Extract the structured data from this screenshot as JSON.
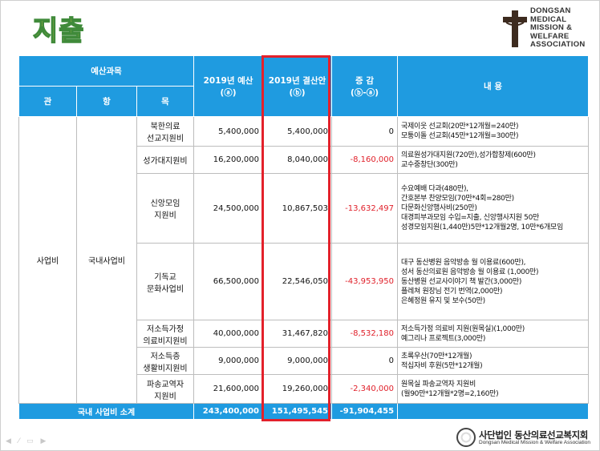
{
  "title": "지출",
  "logo": {
    "lines": [
      "DONGSAN",
      "MEDICAL",
      "MISSION &",
      "WELFARE",
      "ASSOCIATION"
    ],
    "icon": "cross-icon"
  },
  "table": {
    "header": {
      "budget_category": "예산과목",
      "budget_2019": "2019년 예산",
      "budget_2019_sub": "(ⓐ)",
      "settlement_2019": "2019년 결산안",
      "settlement_2019_sub": "(ⓑ)",
      "change": "증  감",
      "change_sub": "(ⓑ-ⓐ)",
      "content": "내    용",
      "gwan": "관",
      "hang": "항",
      "mok": "목"
    },
    "gwan": "사업비",
    "hang": "국내사업비",
    "rows": [
      {
        "mok": [
          "북한의료",
          "선교지원비"
        ],
        "budget": "5,400,000",
        "settlement": "5,400,000",
        "change": "0",
        "negative": false,
        "notes": [
          "국제이웃 선교회(20만*12개월=240만)",
          "모퉁이돌 선교회(45만*12개월=300만)"
        ]
      },
      {
        "mok": [
          "성가대지원비"
        ],
        "budget": "16,200,000",
        "settlement": "8,040,000",
        "change": "-8,160,000",
        "negative": true,
        "notes": [
          "의료원성가대지원(720만),성가합창제(600만)",
          "교수중창단(300만)"
        ]
      },
      {
        "mok": [
          "신앙모임",
          "지원비"
        ],
        "budget": "24,500,000",
        "settlement": "10,867,503",
        "change": "-13,632,497",
        "negative": true,
        "notes": [
          "수요예배 다과(480만),",
          "간호본부 찬양모임(70만*4회=280만)",
          "다문화신앙행사비(250만)",
          "대경피부과모임 수입=지출, 신앙행사지원 50만",
          "성경모임지원(1,440만)5만*12개월2명, 10만*6개모임"
        ]
      },
      {
        "mok": [
          "기독교",
          "문화사업비"
        ],
        "budget": "66,500,000",
        "settlement": "22,546,050",
        "change": "-43,953,950",
        "negative": true,
        "notes": [
          "대구 동산병원 음악방송 월 이용료(600만),",
          "성서 동산의료원 음악방송 월 이용료 (1,000만)",
          "동산병원 선교사이야기 책 발간(3,000만)",
          "플레쳐 원장님 전기 번역(2,000만)",
          "은혜정원 유지 및 보수(50만)"
        ]
      },
      {
        "mok": [
          "저소득가정",
          "의료비지원비"
        ],
        "budget": "40,000,000",
        "settlement": "31,467,820",
        "change": "-8,532,180",
        "negative": true,
        "notes": [
          "저소득가정 의료비 지원(원목실)(1,000만)",
          "예그리나 프로젝트(3,000만)"
        ]
      },
      {
        "mok": [
          "저소득층",
          "생활비지원비"
        ],
        "budget": "9,000,000",
        "settlement": "9,000,000",
        "change": "0",
        "negative": false,
        "notes": [
          "초록우산(70만*12개월)",
          "적십자비 후원(5만*12개월)"
        ]
      },
      {
        "mok": [
          "파송교역자",
          "지원비"
        ],
        "budget": "21,600,000",
        "settlement": "19,260,000",
        "change": "-2,340,000",
        "negative": true,
        "notes": [
          "원목실 파송교역자 지원비",
          " (월90만*12개월*2명=2,160만)"
        ]
      }
    ],
    "total": {
      "label": "국내 사업비 소계",
      "budget": "243,400,000",
      "settlement": "151,495,545",
      "change": "-91,904,455"
    }
  },
  "footer": {
    "org_ko": "사단법인 동산의료선교복지회",
    "org_en": "Dongsan Medical Mission & Welfare Association"
  },
  "colors": {
    "header_blue": "#1f9be0",
    "highlight_red": "#e3212b",
    "negative_red": "#e0202a",
    "title_yellow": "#f4d24b",
    "title_green": "#3f8a3a"
  }
}
